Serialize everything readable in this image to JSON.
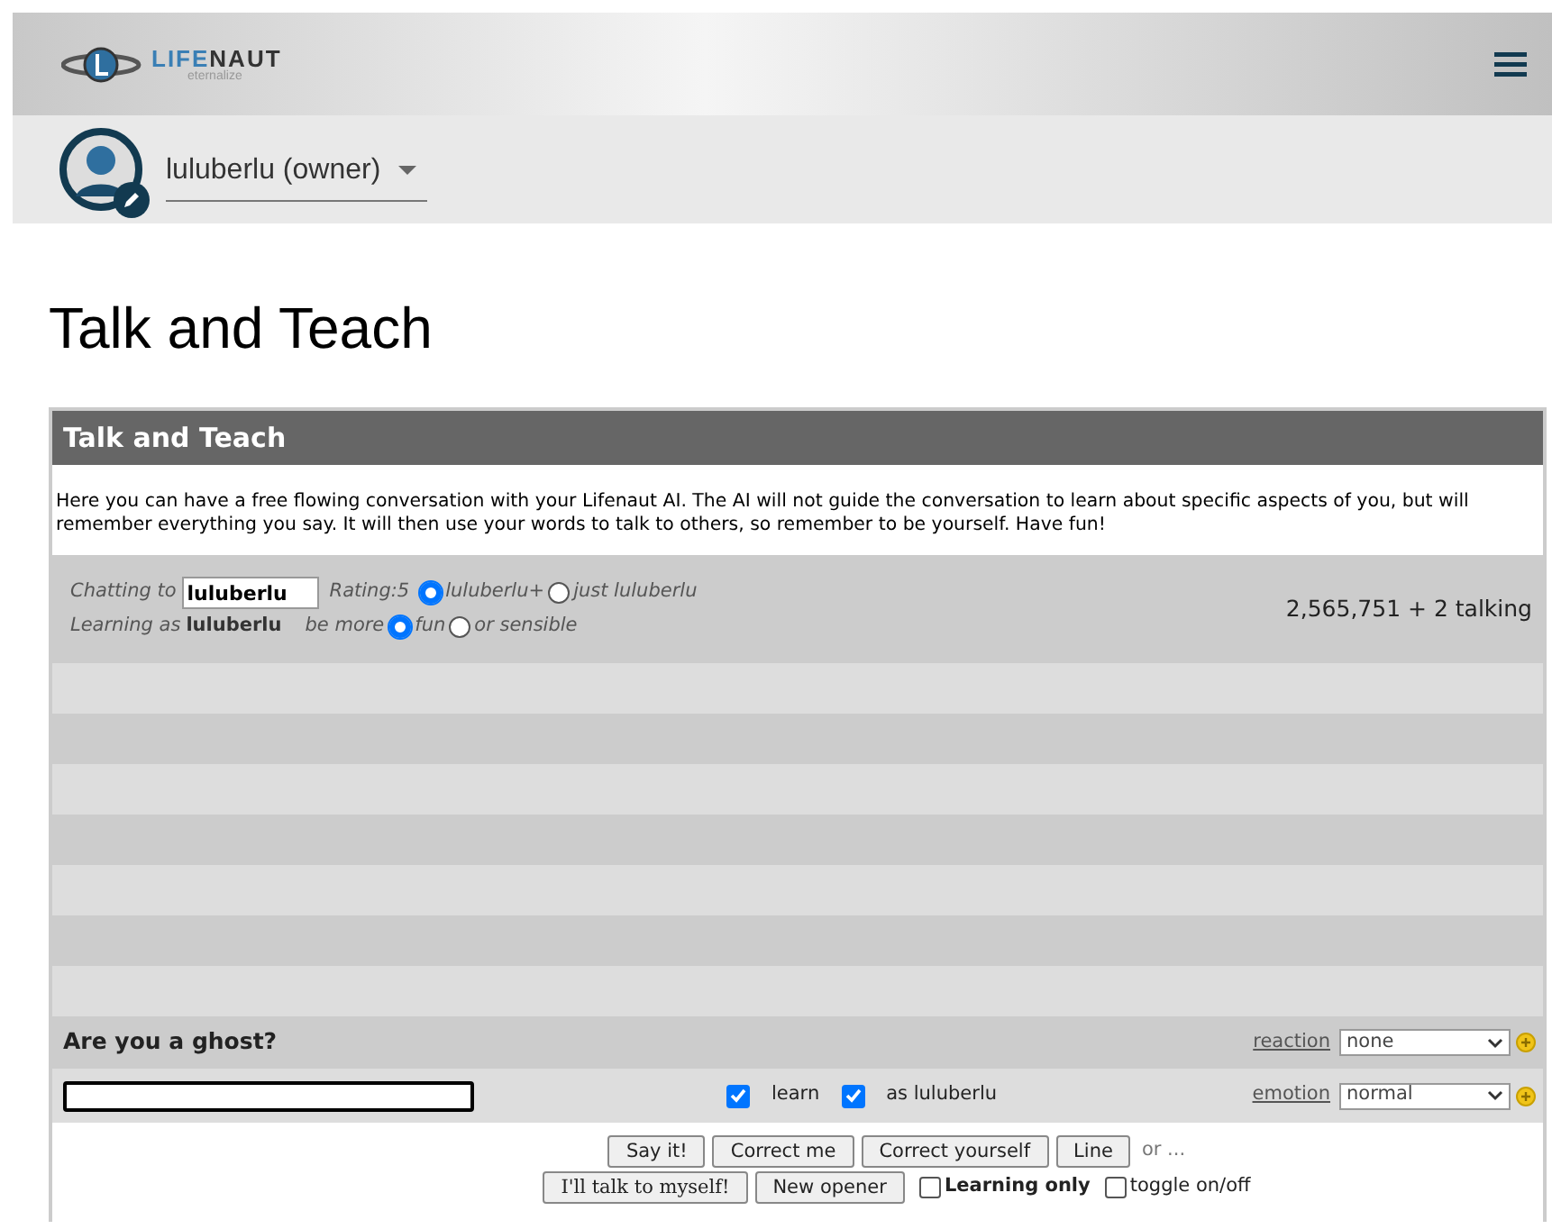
{
  "header": {
    "logo": {
      "part1": "LIFE",
      "part2": "NAUT",
      "tagline": "eternalize"
    }
  },
  "user": {
    "name": "luluberlu (owner)"
  },
  "page_title": "Talk and Teach",
  "panel": {
    "title": "Talk and Teach",
    "description": "Here you can have a free flowing conversation with your Lifenaut AI. The AI will not guide the conversation to learn about specific aspects of you, but will remember everything you say. It will then use your words to talk to others, so remember to be yourself. Have fun!",
    "chatting_label": "Chatting to",
    "chatting_value": "luluberlu",
    "rating": "Rating:5",
    "target_options": [
      {
        "label": "luluberlu+",
        "selected": true
      },
      {
        "label": "just luluberlu",
        "selected": false
      }
    ],
    "learning_label": "Learning as",
    "learning_name": "luluberlu",
    "be_more": "be more",
    "mode_options": [
      {
        "label": "fun",
        "selected": true
      },
      {
        "label": "or sensible",
        "selected": false
      }
    ],
    "talking_count": "2,565,751 + 2 talking",
    "question": "Are you a ghost?",
    "reaction": {
      "label": "reaction",
      "value": "none"
    },
    "emotion": {
      "label": "emotion",
      "value": "normal"
    },
    "checks": [
      {
        "label": "learn",
        "checked": true
      },
      {
        "label": "as luluberlu",
        "checked": true
      }
    ],
    "buttons_row1": [
      "Say it!",
      "Correct me",
      "Correct yourself",
      "Line"
    ],
    "or_text": "or ...",
    "buttons_row2": [
      "I'll talk to myself!",
      "New opener"
    ],
    "options": [
      {
        "label": "Learning only",
        "checked": false,
        "bold": true
      },
      {
        "label": "toggle on/off",
        "checked": false,
        "bold": false
      }
    ]
  }
}
